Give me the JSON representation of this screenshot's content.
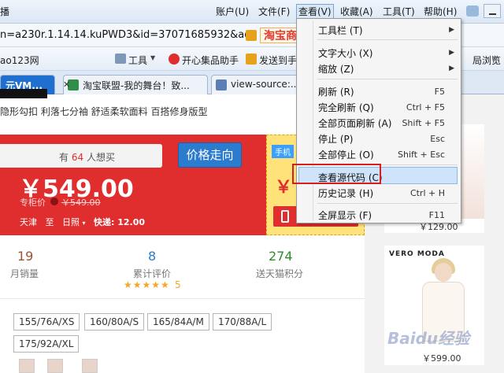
{
  "menubar": {
    "prefix": "播",
    "items": [
      {
        "label": "账户(U)"
      },
      {
        "label": "文件(F)"
      },
      {
        "label": "查看(V)"
      },
      {
        "label": "收藏(A)"
      },
      {
        "label": "工具(T)"
      },
      {
        "label": "帮助(H)"
      }
    ]
  },
  "address": {
    "url": "n=a230r.1.14.14.kuPWD3&id=37071685932&ad",
    "brand": "淘宝商"
  },
  "favorites": {
    "items": [
      {
        "label": "ao123网"
      },
      {
        "label": "工具"
      },
      {
        "label": "开心集品助手"
      },
      {
        "label": "发送到手"
      },
      {
        "label": "局浏览"
      }
    ]
  },
  "tabs": [
    {
      "label": "元VM..."
    },
    {
      "label": "淘宝联盟-我的舞台！致..."
    },
    {
      "label": "view-source:..."
    }
  ],
  "product": {
    "subtitle": "隐形勾扣 利落七分袖 舒适柔软面料 百搭修身版型",
    "want_prefix": "有",
    "want_count": "64",
    "want_suffix": "人想买",
    "go_button": "价格走向",
    "price": "￥549.00",
    "compare_label": "专柜价",
    "compare_price": "￥549.00",
    "ship_from": "天津",
    "ship_to_word": "至",
    "ship_dest": "日照",
    "express": "快递: 12.00",
    "mobile_tag": "手机",
    "mobile_currency": "￥"
  },
  "stats": [
    {
      "value": "19",
      "label": "月销量",
      "color": "#a0522d"
    },
    {
      "value": "8",
      "label": "累计评价",
      "color": "#2b7ccf"
    },
    {
      "value": "274",
      "label": "送天猫积分",
      "color": "#2e8b2e"
    }
  ],
  "rating": {
    "stars": "★★★★★",
    "score": "5"
  },
  "sizes": [
    {
      "label": "155/76A/XS"
    },
    {
      "label": "160/80A/S"
    },
    {
      "label": "165/84A/M"
    },
    {
      "label": "170/88A/L"
    },
    {
      "label": "175/92A/XL"
    }
  ],
  "sidebar": {
    "card1_price": "￥129.00",
    "card2_brand": "VERO MODA",
    "card2_price": "￥599.00",
    "watermark": "Baidu经验"
  },
  "view_menu": {
    "items": [
      {
        "label": "工具栏",
        "key": "(T)",
        "shortcut": "",
        "submenu": true
      },
      {
        "label": "文字大小",
        "key": "(X)",
        "shortcut": "",
        "submenu": true
      },
      {
        "label": "缩放",
        "key": "(Z)",
        "shortcut": "",
        "submenu": true
      },
      {
        "label": "刷新",
        "key": "(R)",
        "shortcut": "F5",
        "submenu": false
      },
      {
        "label": "完全刷新",
        "key": "(Q)",
        "shortcut": "Ctrl + F5",
        "submenu": false
      },
      {
        "label": "全部页面刷新",
        "key": "(A)",
        "shortcut": "Shift + F5",
        "submenu": false
      },
      {
        "label": "停止",
        "key": "(P)",
        "shortcut": "Esc",
        "submenu": false
      },
      {
        "label": "全部停止",
        "key": "(O)",
        "shortcut": "Shift + Esc",
        "submenu": false
      },
      {
        "label": "查看源代码",
        "key": "(C)",
        "shortcut": "",
        "submenu": false
      },
      {
        "label": "历史记录",
        "key": "(H)",
        "shortcut": "Ctrl + H",
        "submenu": false
      },
      {
        "label": "全屏显示",
        "key": "(F)",
        "shortcut": "F11",
        "submenu": false
      }
    ]
  },
  "colors": {
    "price_red": "#e02d2d",
    "tab_blue": "#1e6fcf",
    "highlight_box": "#d71e1e"
  }
}
